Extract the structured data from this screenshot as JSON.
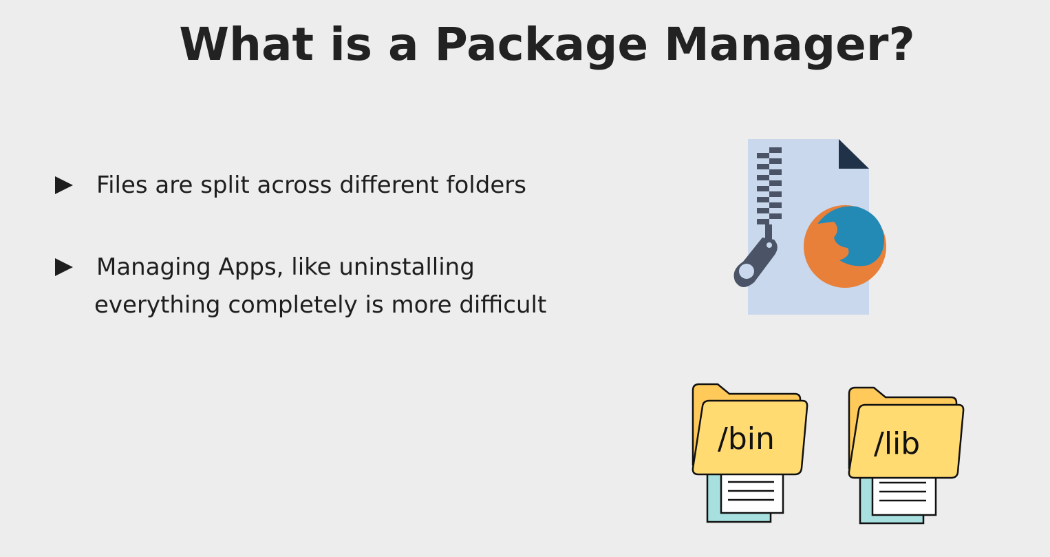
{
  "slide": {
    "title": "What is a Package Manager?",
    "bullets": [
      {
        "lines": [
          "Files are split across different folders"
        ]
      },
      {
        "lines": [
          "Managing Apps, like uninstalling",
          "everything completely is more difficult"
        ]
      }
    ],
    "illustrations": {
      "archive_icon": "zip-file-icon",
      "app_logo": "firefox-logo",
      "folders": [
        {
          "label": "/bin",
          "icon": "folder-icon"
        },
        {
          "label": "/lib",
          "icon": "folder-icon"
        }
      ]
    },
    "colors": {
      "background": "#ededed",
      "text": "#1e1e1e",
      "folder": "#ffd96e",
      "zip_file": "#c9d8ec",
      "firefox_orange": "#e8803a",
      "firefox_blue": "#2389b5"
    }
  }
}
